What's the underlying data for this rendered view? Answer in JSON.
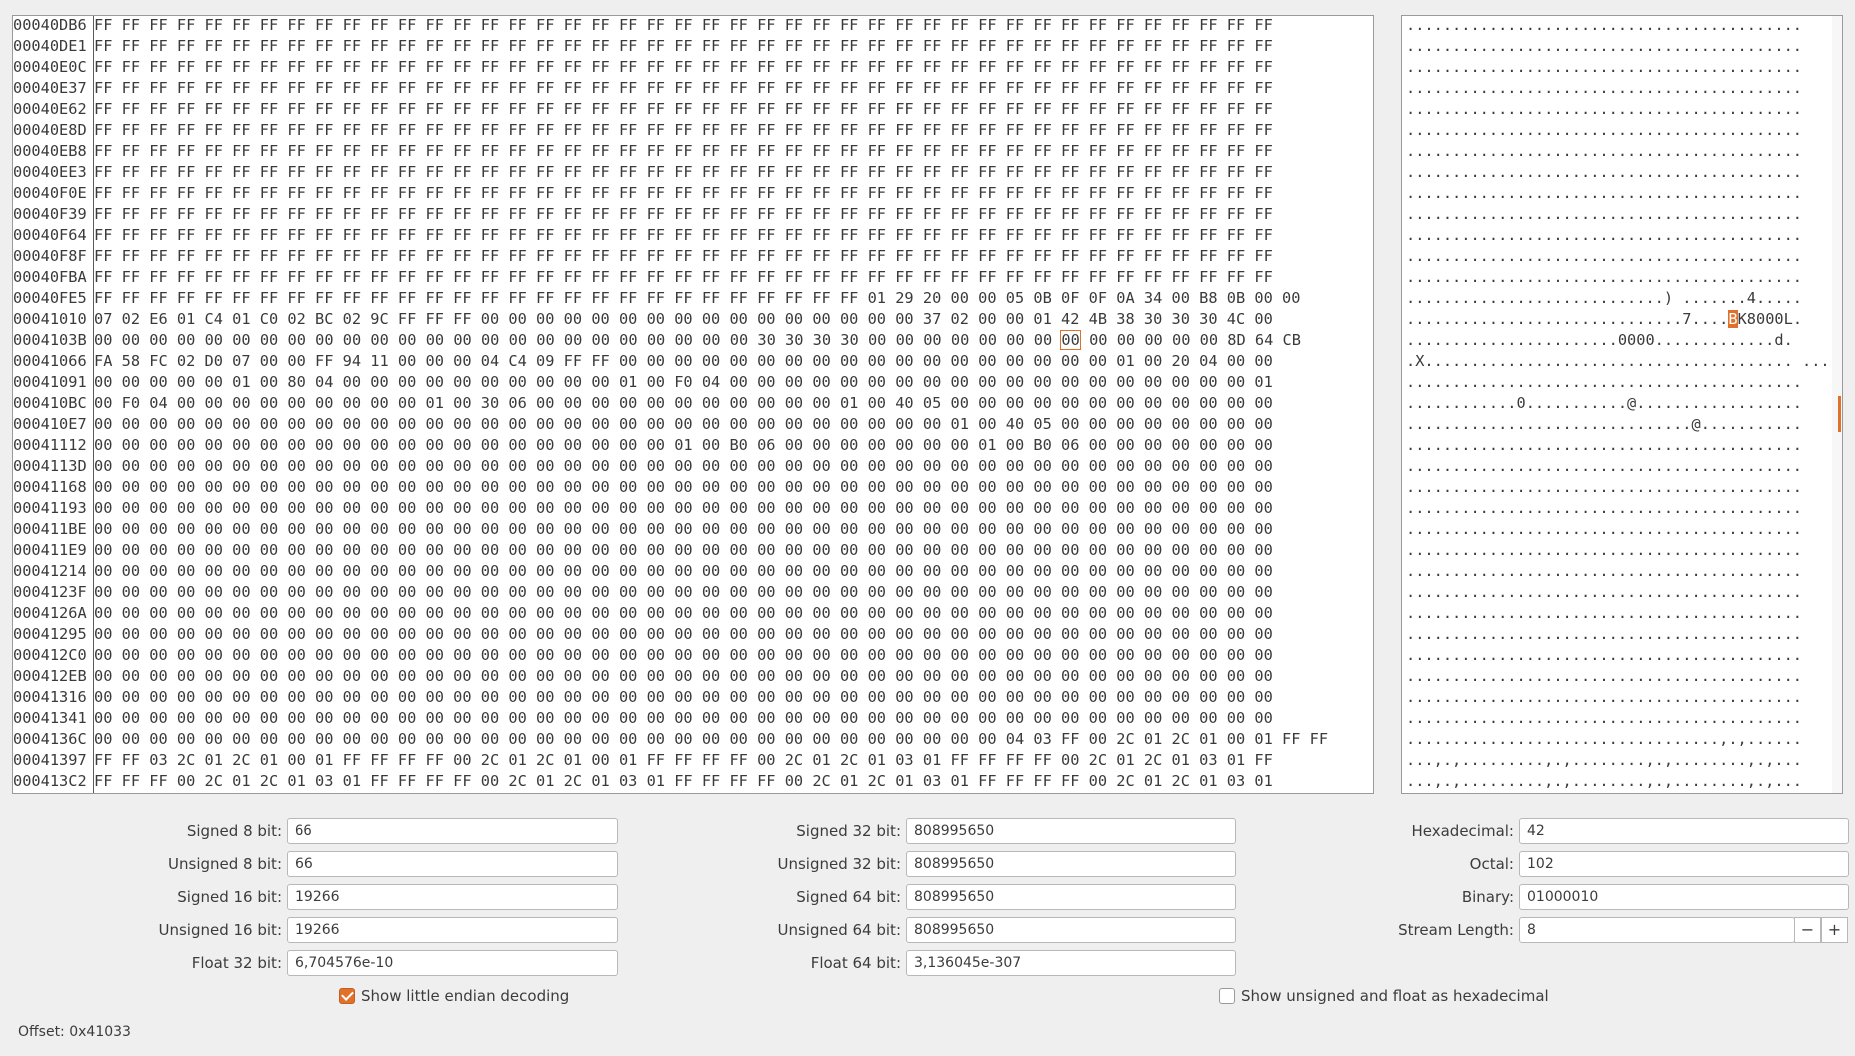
{
  "hex_view": {
    "selected_row": 15,
    "selected_col": 35,
    "rows": [
      {
        "offset": "00040DB6",
        "bytes": "FF FF FF FF FF FF FF FF FF FF FF FF FF FF FF FF FF FF FF FF FF FF FF FF FF FF FF FF FF FF FF FF FF FF FF FF FF FF FF FF FF FF FF"
      },
      {
        "offset": "00040DE1",
        "bytes": "FF FF FF FF FF FF FF FF FF FF FF FF FF FF FF FF FF FF FF FF FF FF FF FF FF FF FF FF FF FF FF FF FF FF FF FF FF FF FF FF FF FF FF"
      },
      {
        "offset": "00040E0C",
        "bytes": "FF FF FF FF FF FF FF FF FF FF FF FF FF FF FF FF FF FF FF FF FF FF FF FF FF FF FF FF FF FF FF FF FF FF FF FF FF FF FF FF FF FF FF"
      },
      {
        "offset": "00040E37",
        "bytes": "FF FF FF FF FF FF FF FF FF FF FF FF FF FF FF FF FF FF FF FF FF FF FF FF FF FF FF FF FF FF FF FF FF FF FF FF FF FF FF FF FF FF FF"
      },
      {
        "offset": "00040E62",
        "bytes": "FF FF FF FF FF FF FF FF FF FF FF FF FF FF FF FF FF FF FF FF FF FF FF FF FF FF FF FF FF FF FF FF FF FF FF FF FF FF FF FF FF FF FF"
      },
      {
        "offset": "00040E8D",
        "bytes": "FF FF FF FF FF FF FF FF FF FF FF FF FF FF FF FF FF FF FF FF FF FF FF FF FF FF FF FF FF FF FF FF FF FF FF FF FF FF FF FF FF FF FF"
      },
      {
        "offset": "00040EB8",
        "bytes": "FF FF FF FF FF FF FF FF FF FF FF FF FF FF FF FF FF FF FF FF FF FF FF FF FF FF FF FF FF FF FF FF FF FF FF FF FF FF FF FF FF FF FF"
      },
      {
        "offset": "00040EE3",
        "bytes": "FF FF FF FF FF FF FF FF FF FF FF FF FF FF FF FF FF FF FF FF FF FF FF FF FF FF FF FF FF FF FF FF FF FF FF FF FF FF FF FF FF FF FF"
      },
      {
        "offset": "00040F0E",
        "bytes": "FF FF FF FF FF FF FF FF FF FF FF FF FF FF FF FF FF FF FF FF FF FF FF FF FF FF FF FF FF FF FF FF FF FF FF FF FF FF FF FF FF FF FF"
      },
      {
        "offset": "00040F39",
        "bytes": "FF FF FF FF FF FF FF FF FF FF FF FF FF FF FF FF FF FF FF FF FF FF FF FF FF FF FF FF FF FF FF FF FF FF FF FF FF FF FF FF FF FF FF"
      },
      {
        "offset": "00040F64",
        "bytes": "FF FF FF FF FF FF FF FF FF FF FF FF FF FF FF FF FF FF FF FF FF FF FF FF FF FF FF FF FF FF FF FF FF FF FF FF FF FF FF FF FF FF FF"
      },
      {
        "offset": "00040F8F",
        "bytes": "FF FF FF FF FF FF FF FF FF FF FF FF FF FF FF FF FF FF FF FF FF FF FF FF FF FF FF FF FF FF FF FF FF FF FF FF FF FF FF FF FF FF FF"
      },
      {
        "offset": "00040FBA",
        "bytes": "FF FF FF FF FF FF FF FF FF FF FF FF FF FF FF FF FF FF FF FF FF FF FF FF FF FF FF FF FF FF FF FF FF FF FF FF FF FF FF FF FF FF FF"
      },
      {
        "offset": "00040FE5",
        "bytes": "FF FF FF FF FF FF FF FF FF FF FF FF FF FF FF FF FF FF FF FF FF FF FF FF FF FF FF FF 01 29 20 00 00 05 0B 0F 0F 0A 34 00 B8 0B 00 00"
      },
      {
        "offset": "00041010",
        "bytes": "07 02 E6 01 C4 01 C0 02 BC 02 9C FF FF FF 00 00 00 00 00 00 00 00 00 00 00 00 00 00 00 00 37 02 00 00 01 42 4B 38 30 30 30 4C 00"
      },
      {
        "offset": "0004103B",
        "bytes": "00 00 00 00 00 00 00 00 00 00 00 00 00 00 00 00 00 00 00 00 00 00 00 00 30 30 30 30 00 00 00 00 00 00 00 00 00 00 00 00 00 8D 64 CB"
      },
      {
        "offset": "00041066",
        "bytes": "FA 58 FC 02 D0 07 00 00 FF 94 11 00 00 00 04 C4 09 FF FF 00 00 00 00 00 00 00 00 00 00 00 00 00 00 00 00 00 00 01 00 20 04 00 00"
      },
      {
        "offset": "00041091",
        "bytes": "00 00 00 00 00 01 00 80 04 00 00 00 00 00 00 00 00 00 00 01 00 F0 04 00 00 00 00 00 00 00 00 00 00 00 00 00 00 00 00 00 00 00 01"
      },
      {
        "offset": "000410BC",
        "bytes": "00 F0 04 00 00 00 00 00 00 00 00 00 01 00 30 06 00 00 00 00 00 00 00 00 00 00 00 01 00 40 05 00 00 00 00 00 00 00 00 00 00 00 00"
      },
      {
        "offset": "000410E7",
        "bytes": "00 00 00 00 00 00 00 00 00 00 00 00 00 00 00 00 00 00 00 00 00 00 00 00 00 00 00 00 00 00 00 01 00 40 05 00 00 00 00 00 00 00 00"
      },
      {
        "offset": "00041112",
        "bytes": "00 00 00 00 00 00 00 00 00 00 00 00 00 00 00 00 00 00 00 00 00 01 00 B0 06 00 00 00 00 00 00 00 01 00 B0 06 00 00 00 00 00 00 00"
      },
      {
        "offset": "0004113D",
        "bytes": "00 00 00 00 00 00 00 00 00 00 00 00 00 00 00 00 00 00 00 00 00 00 00 00 00 00 00 00 00 00 00 00 00 00 00 00 00 00 00 00 00 00 00"
      },
      {
        "offset": "00041168",
        "bytes": "00 00 00 00 00 00 00 00 00 00 00 00 00 00 00 00 00 00 00 00 00 00 00 00 00 00 00 00 00 00 00 00 00 00 00 00 00 00 00 00 00 00 00"
      },
      {
        "offset": "00041193",
        "bytes": "00 00 00 00 00 00 00 00 00 00 00 00 00 00 00 00 00 00 00 00 00 00 00 00 00 00 00 00 00 00 00 00 00 00 00 00 00 00 00 00 00 00 00"
      },
      {
        "offset": "000411BE",
        "bytes": "00 00 00 00 00 00 00 00 00 00 00 00 00 00 00 00 00 00 00 00 00 00 00 00 00 00 00 00 00 00 00 00 00 00 00 00 00 00 00 00 00 00 00"
      },
      {
        "offset": "000411E9",
        "bytes": "00 00 00 00 00 00 00 00 00 00 00 00 00 00 00 00 00 00 00 00 00 00 00 00 00 00 00 00 00 00 00 00 00 00 00 00 00 00 00 00 00 00 00"
      },
      {
        "offset": "00041214",
        "bytes": "00 00 00 00 00 00 00 00 00 00 00 00 00 00 00 00 00 00 00 00 00 00 00 00 00 00 00 00 00 00 00 00 00 00 00 00 00 00 00 00 00 00 00"
      },
      {
        "offset": "0004123F",
        "bytes": "00 00 00 00 00 00 00 00 00 00 00 00 00 00 00 00 00 00 00 00 00 00 00 00 00 00 00 00 00 00 00 00 00 00 00 00 00 00 00 00 00 00 00"
      },
      {
        "offset": "0004126A",
        "bytes": "00 00 00 00 00 00 00 00 00 00 00 00 00 00 00 00 00 00 00 00 00 00 00 00 00 00 00 00 00 00 00 00 00 00 00 00 00 00 00 00 00 00 00"
      },
      {
        "offset": "00041295",
        "bytes": "00 00 00 00 00 00 00 00 00 00 00 00 00 00 00 00 00 00 00 00 00 00 00 00 00 00 00 00 00 00 00 00 00 00 00 00 00 00 00 00 00 00 00"
      },
      {
        "offset": "000412C0",
        "bytes": "00 00 00 00 00 00 00 00 00 00 00 00 00 00 00 00 00 00 00 00 00 00 00 00 00 00 00 00 00 00 00 00 00 00 00 00 00 00 00 00 00 00 00"
      },
      {
        "offset": "000412EB",
        "bytes": "00 00 00 00 00 00 00 00 00 00 00 00 00 00 00 00 00 00 00 00 00 00 00 00 00 00 00 00 00 00 00 00 00 00 00 00 00 00 00 00 00 00 00"
      },
      {
        "offset": "00041316",
        "bytes": "00 00 00 00 00 00 00 00 00 00 00 00 00 00 00 00 00 00 00 00 00 00 00 00 00 00 00 00 00 00 00 00 00 00 00 00 00 00 00 00 00 00 00"
      },
      {
        "offset": "00041341",
        "bytes": "00 00 00 00 00 00 00 00 00 00 00 00 00 00 00 00 00 00 00 00 00 00 00 00 00 00 00 00 00 00 00 00 00 00 00 00 00 00 00 00 00 00 00"
      },
      {
        "offset": "0004136C",
        "bytes": "00 00 00 00 00 00 00 00 00 00 00 00 00 00 00 00 00 00 00 00 00 00 00 00 00 00 00 00 00 00 00 00 00 04 03 FF 00 2C 01 2C 01 00 01 FF FF"
      },
      {
        "offset": "00041397",
        "bytes": "FF FF 03 2C 01 2C 01 00 01 FF FF FF FF 00 2C 01 2C 01 00 01 FF FF FF FF 00 2C 01 2C 01 03 01 FF FF FF FF 00 2C 01 2C 01 03 01 FF"
      },
      {
        "offset": "000413C2",
        "bytes": "FF FF FF 00 2C 01 2C 01 03 01 FF FF FF FF 00 2C 01 2C 01 03 01 FF FF FF FF 00 2C 01 2C 01 03 01 FF FF FF FF 00 2C 01 2C 01 03 01"
      }
    ],
    "ascii_rows": [
      "...........................................",
      "...........................................",
      "...........................................",
      "...........................................",
      "...........................................",
      "...........................................",
      "...........................................",
      "...........................................",
      "...........................................",
      "...........................................",
      "...........................................",
      "...........................................",
      "...........................................",
      "............................) .......4.....",
      "..............................7....BK8000L.",
      ".......................0000.............d.",
      ".X........................................ ...",
      "...........................................",
      "............0...........@..................",
      "...............................@...........",
      "...........................................",
      "...........................................",
      "...........................................",
      "...........................................",
      "...........................................",
      "...........................................",
      "...........................................",
      "...........................................",
      "...........................................",
      "...........................................",
      "...........................................",
      "...........................................",
      "...........................................",
      "...........................................",
      "..................................,.,......",
      "...,.,.........,.,........,.,........,.,...",
      "...,.,.........,.,........,.,........,.,..."
    ],
    "ascii_selected_row": 14,
    "ascii_selected_col": 35
  },
  "decoder": {
    "signed_8_label": "Signed 8 bit:",
    "signed_8": "66",
    "unsigned_8_label": "Unsigned 8 bit:",
    "unsigned_8": "66",
    "signed_16_label": "Signed 16 bit:",
    "signed_16": "19266",
    "unsigned_16_label": "Unsigned 16 bit:",
    "unsigned_16": "19266",
    "float_32_label": "Float 32 bit:",
    "float_32": "6,704576e-10",
    "signed_32_label": "Signed 32 bit:",
    "signed_32": "808995650",
    "unsigned_32_label": "Unsigned 32 bit:",
    "unsigned_32": "808995650",
    "signed_64_label": "Signed 64 bit:",
    "signed_64": "808995650",
    "unsigned_64_label": "Unsigned 64 bit:",
    "unsigned_64": "808995650",
    "float_64_label": "Float 64 bit:",
    "float_64": "3,136045e-307",
    "hex_label": "Hexadecimal:",
    "hex": "42",
    "octal_label": "Octal:",
    "octal": "102",
    "binary_label": "Binary:",
    "binary": "01000010",
    "stream_length_label": "Stream Length:",
    "stream_length": "8",
    "minus": "−",
    "plus": "+",
    "little_endian_label": "Show little endian decoding",
    "little_endian_checked": true,
    "hex_unsigned_label": "Show unsigned and float as hexadecimal",
    "hex_unsigned_checked": false
  },
  "status": {
    "offset": "Offset: 0x41033"
  },
  "colors": {
    "accent": "#e0712a"
  }
}
